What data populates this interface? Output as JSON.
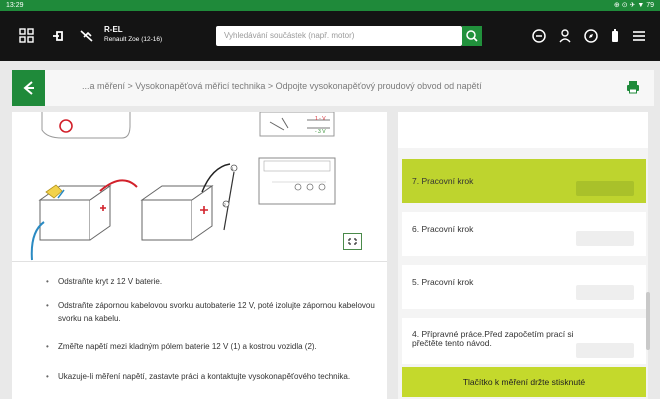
{
  "status_bar": {
    "time": "13:29",
    "right_icons": "⊕ ⊙ ✈ ▼ 79"
  },
  "app_bar": {
    "vehicle_code": "R-EL",
    "vehicle_name": "Renault Zoe (12-16)",
    "search_placeholder": "Vyhledávání součástek (např. motor)",
    "icons": [
      "grid-icon",
      "tool-icon",
      "wrench-off-icon",
      "search-icon",
      "minus-circle-icon",
      "user-icon",
      "compass-icon",
      "battery-icon",
      "menu-icon"
    ]
  },
  "breadcrumb": {
    "text": "...a měření > Vysokonapěťová měřicí technika > Odpojte vysokonapěťový proudový obvod od napětí"
  },
  "instructions": [
    "Odstraňte kryt z 12 V baterie.",
    "Odstraňte zápornou kabelovou svorku autobaterie 12 V, poté izolujte zápornou kabelovou svorku na kabelu.",
    "Změřte napětí mezi kladným pólem baterie 12 V (1) a kostrou vozidla (2).",
    "Ukazuje-li měření napětí, zastavte práci a kontaktujte vysokonapěťového technika."
  ],
  "figure": {
    "label_1": "1",
    "label_2": "2",
    "meter_label_1": "1 - V",
    "meter_label_2": "- 3 V"
  },
  "steps_panel": {
    "steps": [
      {
        "label": "7. Pracovní krok",
        "active": true
      },
      {
        "label": "6. Pracovní krok",
        "active": false
      },
      {
        "label": "5. Pracovní krok",
        "active": false
      },
      {
        "label": "4. Přípravné práce.Před započetím prací si přečtěte tento návod.",
        "active": false
      }
    ],
    "hold_button": "Tlačítko k měření držte stisknuté"
  },
  "colors": {
    "brand_green": "#1f8a3a",
    "active_step": "#bed42e",
    "appbar": "#141414"
  }
}
